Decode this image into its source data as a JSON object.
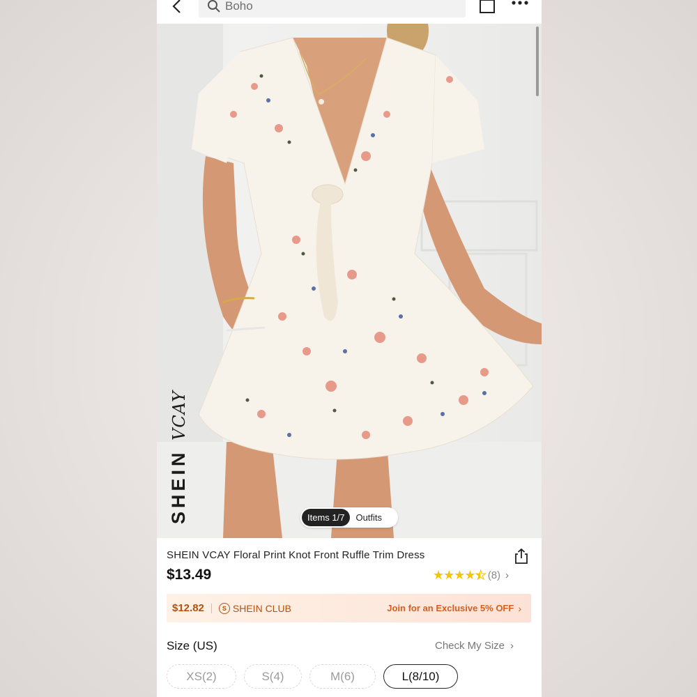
{
  "header": {
    "search_value": "Boho"
  },
  "gallery": {
    "brand_main": "SHEIN",
    "brand_script": "VCAY",
    "items_tab": "Items 1/7",
    "outfits_tab": "Outfits"
  },
  "product": {
    "title": "SHEIN VCAY Floral Print Knot Front Ruffle Trim Dress",
    "price": "$13.49",
    "rating_value": 4.5,
    "rating_count": "(8)"
  },
  "club": {
    "price": "$12.82",
    "name": "SHEIN CLUB",
    "cta": "Join for an Exclusive 5% OFF"
  },
  "size": {
    "label": "Size (US)",
    "check_link": "Check My Size",
    "options": [
      "XS(2)",
      "S(4)",
      "M(6)",
      "L(8/10)"
    ],
    "selected": "L(8/10)"
  },
  "colors": {
    "star": "#f7c400",
    "club_text": "#b5510f",
    "club_cta": "#d45f1e"
  },
  "icons": [
    "back-arrow-icon",
    "search-icon",
    "bag-icon",
    "more-icon",
    "share-icon",
    "star-icon",
    "chevron-right-icon"
  ]
}
